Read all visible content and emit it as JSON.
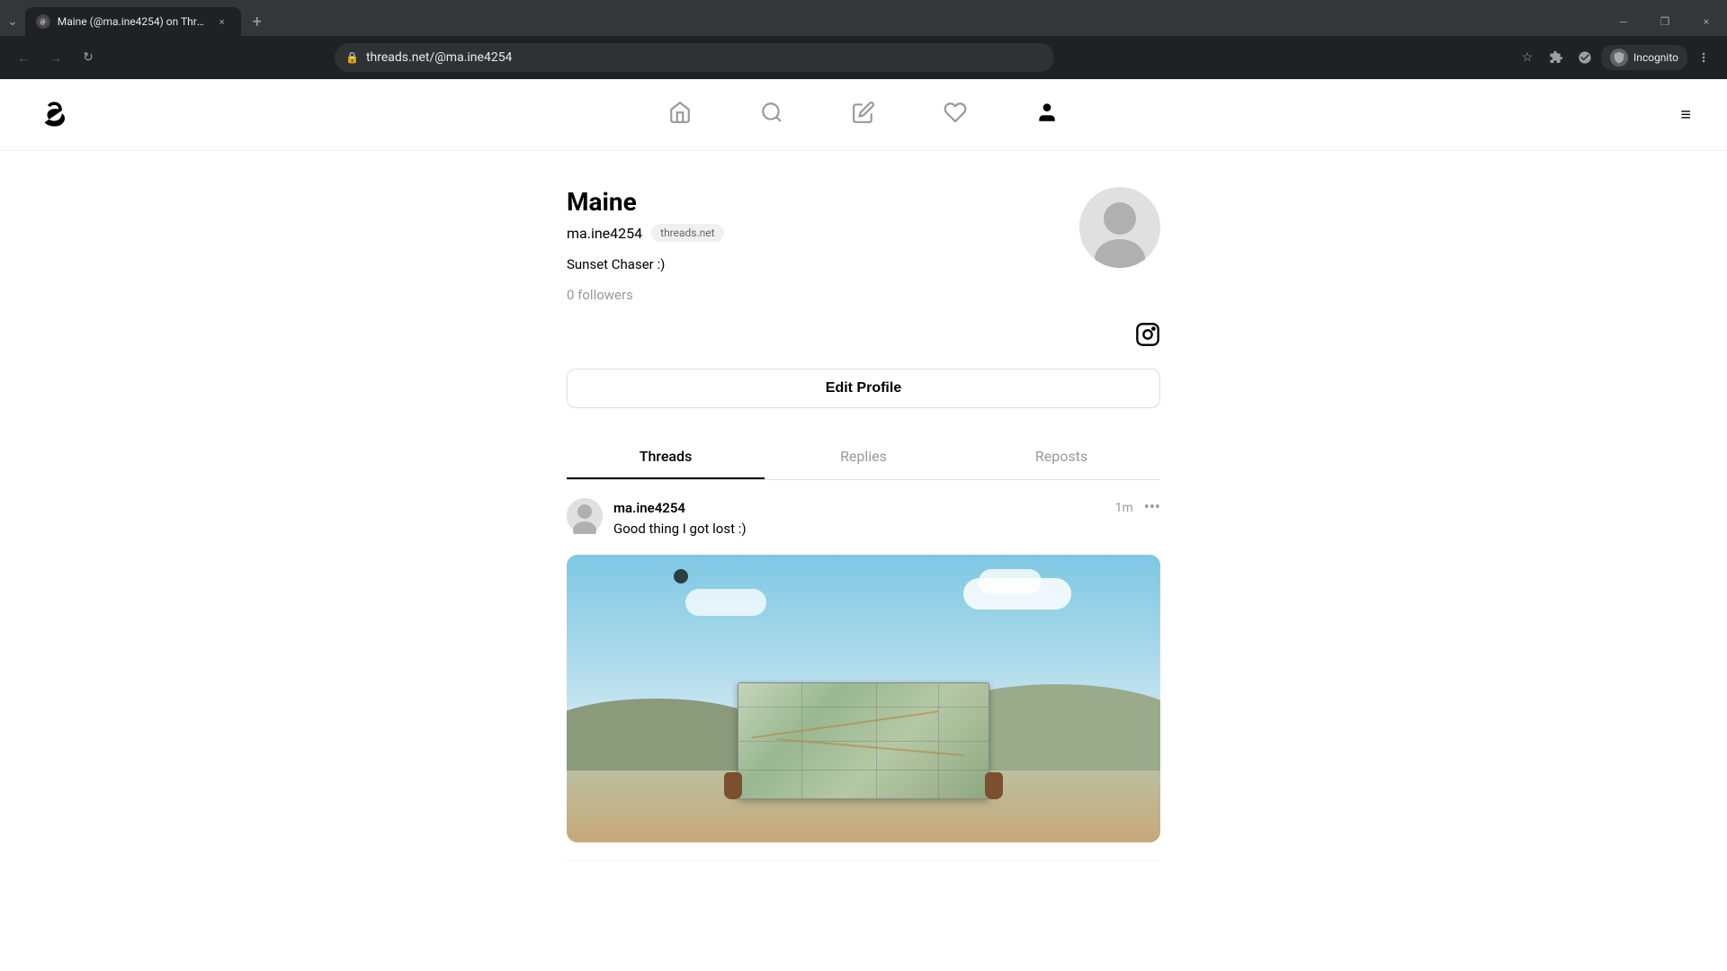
{
  "browser": {
    "tab_title": "Maine (@ma.ine4254) on Threa...",
    "tab_favicon": "@",
    "address": "threads.net/@ma.ine4254",
    "close_tab_icon": "×",
    "new_tab_icon": "+",
    "back_icon": "←",
    "forward_icon": "→",
    "reload_icon": "↻",
    "bookmark_icon": "☆",
    "profile_icon": "⊙",
    "incognito_label": "Incognito",
    "window_minimize": "─",
    "window_restore": "❐",
    "window_close": "×",
    "tab_list_icon": "⌄",
    "menu_icon": "≡"
  },
  "app": {
    "logo": "@",
    "nav": {
      "home_label": "home",
      "search_label": "search",
      "compose_label": "compose",
      "activity_label": "activity",
      "profile_label": "profile"
    },
    "menu_icon": "≡"
  },
  "profile": {
    "name": "Maine",
    "username": "ma.ine4254",
    "badge": "threads.net",
    "bio": "Sunset Chaser :)",
    "followers": "0 followers",
    "edit_profile_label": "Edit Profile",
    "instagram_icon": "⊙"
  },
  "tabs": {
    "threads_label": "Threads",
    "replies_label": "Replies",
    "reposts_label": "Reposts"
  },
  "post": {
    "username": "ma.ine4254",
    "time": "1m",
    "text": "Good thing I got lost :)",
    "more_icon": "•••"
  }
}
